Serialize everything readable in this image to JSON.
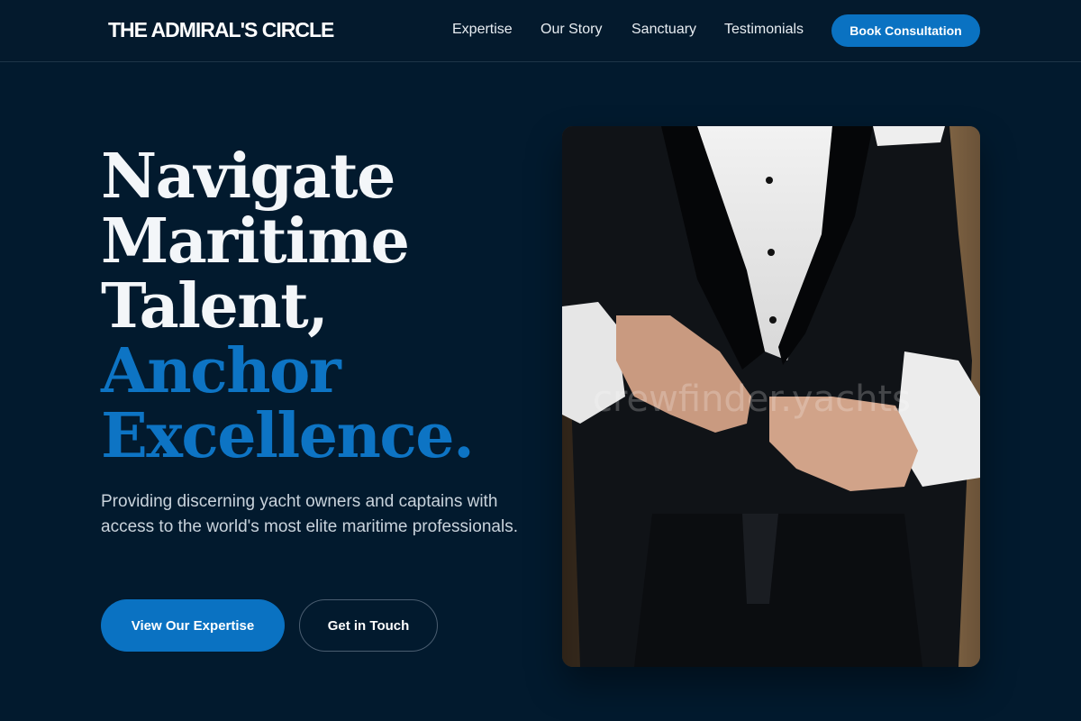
{
  "header": {
    "brand": "THE ADMIRAL'S CIRCLE",
    "nav": [
      "Expertise",
      "Our Story",
      "Sanctuary",
      "Testimonials"
    ],
    "cta": "Book Consultation"
  },
  "hero": {
    "headline_white": [
      "Navigate",
      "Maritime",
      "Talent,"
    ],
    "headline_blue": [
      "Anchor",
      "Excellence."
    ],
    "subtext": "Providing discerning yacht owners and captains with access to the world's most elite maritime professionals.",
    "primary_button": "View Our Expertise",
    "secondary_button": "Get in Touch",
    "image_watermark": "crewfinder.yachts",
    "image_icon": "tuxedo-photo"
  },
  "colors": {
    "background": "#021a2e",
    "accent": "#0a72c2",
    "headline_blue": "#0d74c4"
  }
}
